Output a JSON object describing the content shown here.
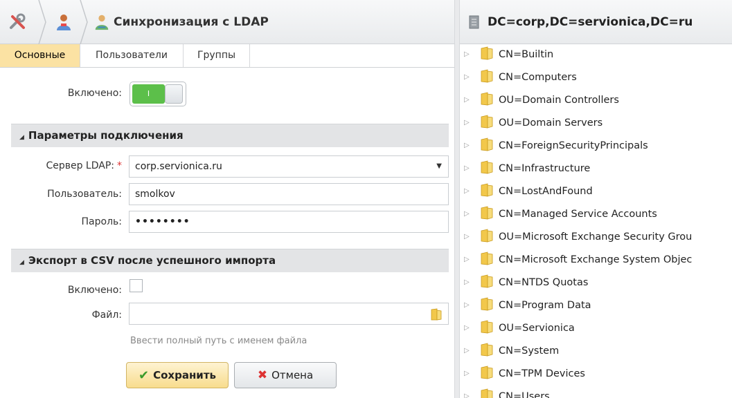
{
  "header": {
    "title": "Синхронизация с LDAP",
    "icons": [
      "tools-icon",
      "users-icon",
      "sync-users-icon"
    ]
  },
  "tabs": [
    {
      "label": "Основные",
      "active": true
    },
    {
      "label": "Пользователи",
      "active": false
    },
    {
      "label": "Группы",
      "active": false
    }
  ],
  "enabled": {
    "label": "Включено:",
    "toggle_text": "I",
    "value": true
  },
  "connection": {
    "section_title": "Параметры подключения",
    "server_label": "Сервер LDAP:",
    "server_required": "*",
    "server_value": "corp.servionica.ru",
    "user_label": "Пользователь:",
    "user_value": "smolkov",
    "password_label": "Пароль:",
    "password_value": "••••••••"
  },
  "export": {
    "section_title": "Экспорт в CSV после успешного импорта",
    "enabled_label": "Включено:",
    "enabled_value": false,
    "file_label": "Файл:",
    "file_value": "",
    "file_hint": "Ввести полный путь с именем файла"
  },
  "buttons": {
    "save": "Сохранить",
    "cancel": "Отмена"
  },
  "tree": {
    "title": "DC=corp,DC=servionica,DC=ru",
    "items": [
      "CN=Builtin",
      "CN=Computers",
      "OU=Domain Controllers",
      "OU=Domain Servers",
      "CN=ForeignSecurityPrincipals",
      "CN=Infrastructure",
      "CN=LostAndFound",
      "CN=Managed Service Accounts",
      "OU=Microsoft Exchange Security Grou",
      "CN=Microsoft Exchange System Objec",
      "CN=NTDS Quotas",
      "CN=Program Data",
      "OU=Servionica",
      "CN=System",
      "CN=TPM Devices",
      "CN=Users"
    ]
  },
  "colors": {
    "accent_tab": "#fbe2a3",
    "toggle_on": "#5cbf4a",
    "folder": "#f2c84b",
    "save_button": "#f8dc8d"
  }
}
